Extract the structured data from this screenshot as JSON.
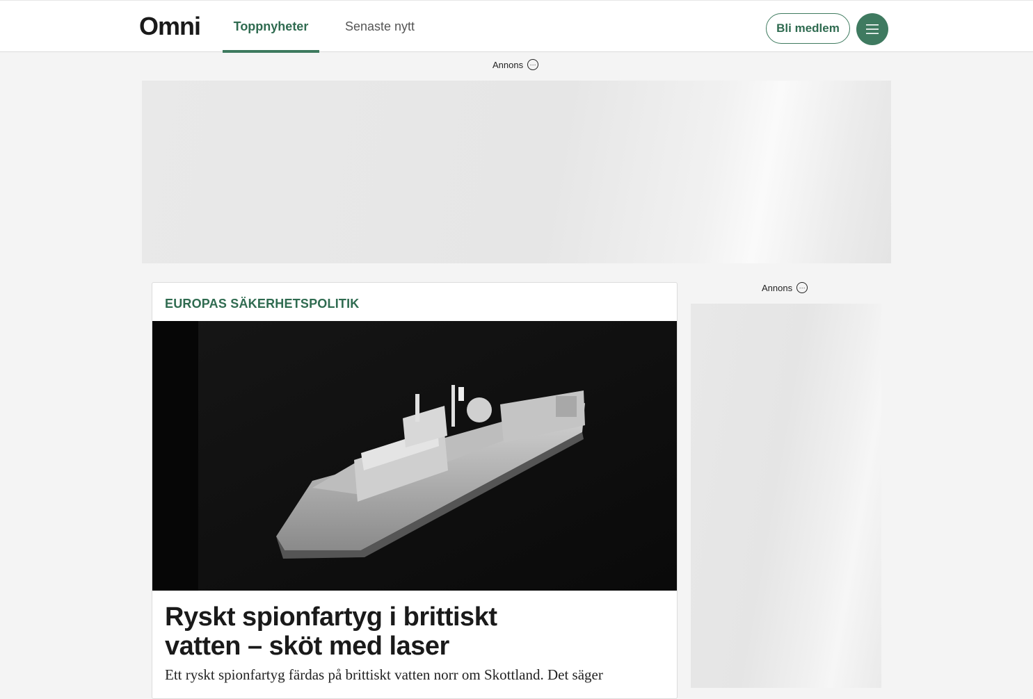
{
  "header": {
    "logo": "Omni",
    "tabs": [
      {
        "label": "Toppnyheter",
        "active": true
      },
      {
        "label": "Senaste nytt",
        "active": false
      }
    ],
    "member_button": "Bli medlem",
    "menu_icon": "hamburger-menu-icon"
  },
  "ads": {
    "top_label": "Annons",
    "side_label": "Annons",
    "options_icon": "more-options-icon"
  },
  "article": {
    "topic": "EUROPAS SÄKERHETSPOLITIK",
    "headline": "Ryskt spionfartyg i brittiskt vatten – sköt med laser",
    "lead": "Ett ryskt spionfartyg färdas på brittiskt vatten norr om Skottland. Det säger"
  },
  "colors": {
    "accent": "#3d7a5e",
    "accent_text": "#2f6b50",
    "page_background": "#f4f4f4"
  }
}
